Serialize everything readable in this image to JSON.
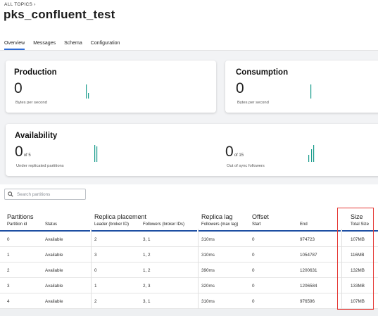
{
  "breadcrumb": "ALL TOPICS ›",
  "title": "pks_confluent_test",
  "tabs": [
    "Overview",
    "Messages",
    "Schema",
    "Configuration"
  ],
  "production": {
    "title": "Production",
    "value": "0",
    "caption": "Bytes per second"
  },
  "consumption": {
    "title": "Consumption",
    "value": "0",
    "caption": "Bytes per second"
  },
  "availability": {
    "title": "Availability",
    "under": {
      "value": "0",
      "of": "of 5",
      "caption": "Under replicated partitions"
    },
    "sync": {
      "value": "0",
      "of": "of 15",
      "caption": "Out of sync followers"
    }
  },
  "search": {
    "placeholder": "Search partitions"
  },
  "table": {
    "groups": {
      "partitions": "Partitions",
      "replica": "Replica placement",
      "lag": "Replica lag",
      "offset": "Offset",
      "size": "Size"
    },
    "columns": {
      "partition_id": "Partition id",
      "status": "Status",
      "leader": "Leader (broker ID)",
      "followers": "Followers (broker IDs)",
      "lag": "Followers (max lag)",
      "start": "Start",
      "end": "End",
      "total_size": "Total Size"
    },
    "rows": [
      {
        "id": "0",
        "status": "Available",
        "leader": "2",
        "followers": "3, 1",
        "lag": "310ms",
        "start": "0",
        "end": "974723",
        "size": "107MB"
      },
      {
        "id": "1",
        "status": "Available",
        "leader": "3",
        "followers": "1, 2",
        "lag": "310ms",
        "start": "0",
        "end": "1054787",
        "size": "116MB"
      },
      {
        "id": "2",
        "status": "Available",
        "leader": "0",
        "followers": "1, 2",
        "lag": "390ms",
        "start": "0",
        "end": "1200631",
        "size": "132MB"
      },
      {
        "id": "3",
        "status": "Available",
        "leader": "1",
        "followers": "2, 3",
        "lag": "320ms",
        "start": "0",
        "end": "1206584",
        "size": "133MB"
      },
      {
        "id": "4",
        "status": "Available",
        "leader": "2",
        "followers": "3, 1",
        "lag": "310ms",
        "start": "0",
        "end": "976596",
        "size": "107MB"
      }
    ]
  },
  "colors": {
    "accent": "#2d6bd6",
    "spark": "#1a9c8c",
    "highlight": "#e53935",
    "header_line": "#1e4fa3"
  }
}
